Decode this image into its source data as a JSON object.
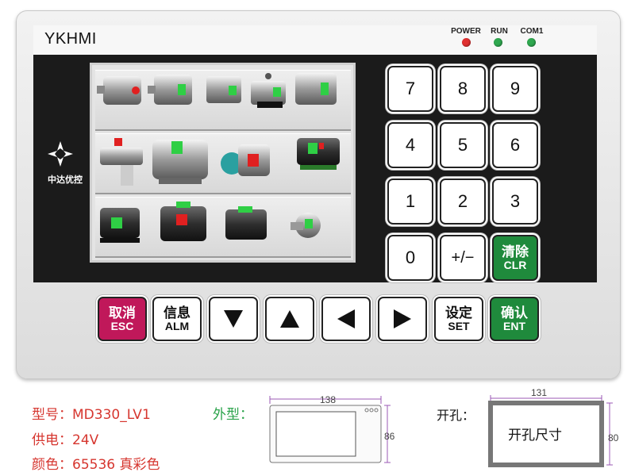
{
  "device": {
    "brand": "YKHMI",
    "logo_text": "中达优控",
    "leds": [
      {
        "label": "POWER",
        "color": "#e03030"
      },
      {
        "label": "RUN",
        "color": "#2fa84f"
      },
      {
        "label": "COM1",
        "color": "#2fa84f"
      }
    ],
    "keypad": {
      "rows": [
        [
          "7",
          "8",
          "9"
        ],
        [
          "4",
          "5",
          "6"
        ],
        [
          "1",
          "2",
          "3"
        ]
      ],
      "zero": "0",
      "sign": "+/−",
      "clear": {
        "cn": "清除",
        "en": "CLR",
        "color": "#1f8a3c"
      }
    },
    "function_keys": {
      "esc": {
        "cn": "取消",
        "en": "ESC",
        "color": "#c0185a"
      },
      "alm": {
        "cn": "信息",
        "en": "ALM"
      },
      "set": {
        "cn": "设定",
        "en": "SET"
      },
      "ent": {
        "cn": "确认",
        "en": "ENT",
        "color": "#1f8a3c"
      }
    }
  },
  "specs": {
    "model": "型号：MD330_LV1",
    "power": "供电：24V",
    "color": "颜色：65536 真彩色",
    "outline_label": "外型：",
    "outline_width": "138",
    "outline_height": "86",
    "cutout_label": "开孔：",
    "cutout_width": "131",
    "cutout_height": "80",
    "cutout_text": "开孔尺寸"
  },
  "colors": {
    "panel": "#1b1b1b",
    "status_green": "#2fcf45",
    "status_red": "#e02020"
  }
}
